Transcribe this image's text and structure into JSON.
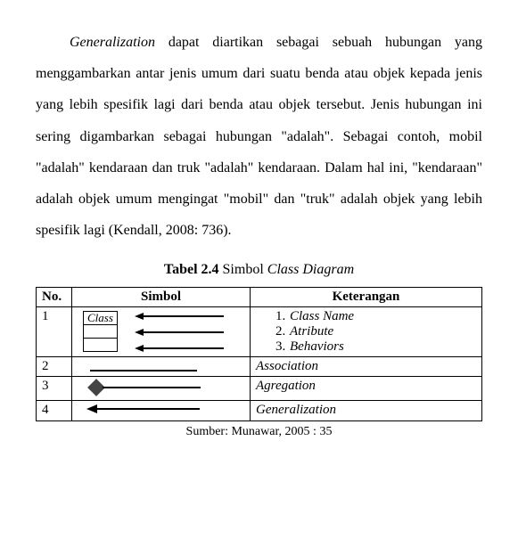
{
  "paragraph": {
    "term": "Generalization",
    "rest": " dapat diartikan sebagai sebuah hubungan yang menggambarkan antar jenis umum dari suatu benda atau objek kepada jenis yang lebih spesifik lagi dari benda atau objek tersebut. Jenis hubungan ini sering digambarkan sebagai hubungan \"adalah\". Sebagai contoh, mobil \"adalah\" kendaraan dan truk \"adalah\" kendaraan. Dalam hal ini, \"kendaraan\" adalah objek umum mengingat \"mobil\" dan \"truk\" adalah objek yang lebih spesifik lagi (Kendall, 2008: 736)."
  },
  "table_title": {
    "label": "Tabel 2.4",
    "desc_prefix": " Simbol ",
    "desc_italic": "Class Diagram"
  },
  "headers": {
    "no": "No.",
    "simbol": "Simbol",
    "keterangan": "Keterangan"
  },
  "rows": [
    {
      "no": "1",
      "class_label": "Class",
      "keterangan": [
        {
          "n": "1.",
          "text": "Class Name"
        },
        {
          "n": "2.",
          "text": "Atribute"
        },
        {
          "n": "3.",
          "text": "Behaviors"
        }
      ]
    },
    {
      "no": "2",
      "keterangan": "Association"
    },
    {
      "no": "3",
      "keterangan": "Agregation"
    },
    {
      "no": "4",
      "keterangan": "Generalization"
    }
  ],
  "source": "Sumber: Munawar, 2005 : 35"
}
